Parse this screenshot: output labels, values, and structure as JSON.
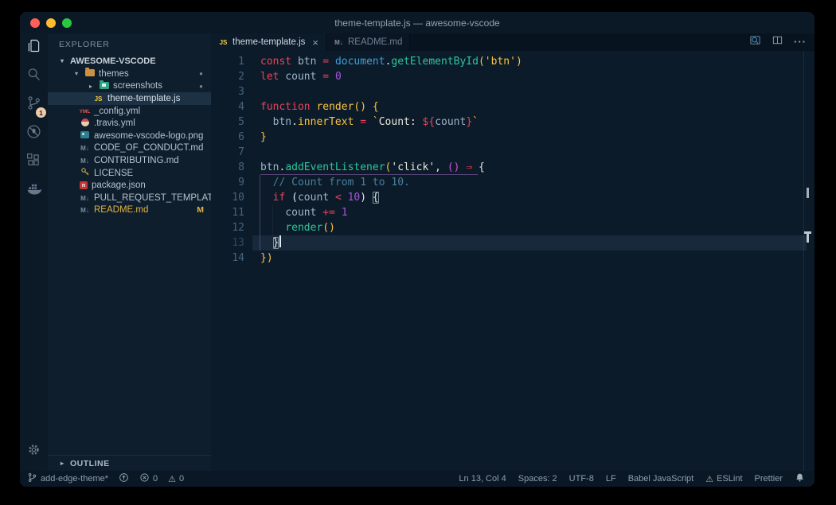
{
  "window": {
    "title": "theme-template.js — awesome-vscode",
    "traffic_lights": {
      "close": "#ff5f57",
      "minimize": "#febc2e",
      "zoom": "#28c840"
    }
  },
  "colors": {
    "keyword_red": "#ee4159",
    "string_yellow": "#fdc33f",
    "method_green": "#2ec59c",
    "object_blue": "#3f9ed8",
    "number_purple": "#a655d8",
    "paren_magenta": "#cf52d8",
    "comment_blue": "#4a7f9d",
    "variable_slate": "#9db4c6",
    "modified_gold": "#e3b341",
    "scm_badge_peach": "#eecaa9",
    "editor_bg": "#0c1b29",
    "sidebar_bg": "#0e1e2d",
    "statusbar_bg": "#0a1724"
  },
  "activity_bar": {
    "items": [
      {
        "icon": "files-icon",
        "active": true
      },
      {
        "icon": "search-icon"
      },
      {
        "icon": "source-control-icon",
        "badge": "1"
      },
      {
        "icon": "debug-icon"
      },
      {
        "icon": "extensions-icon"
      },
      {
        "icon": "docker-icon"
      }
    ],
    "bottom": [
      {
        "icon": "settings-gear-icon"
      }
    ]
  },
  "sidebar": {
    "header": "EXPLORER",
    "root": {
      "label": "AWESOME-VSCODE",
      "arrow": "▾"
    },
    "tree": [
      {
        "label": "themes",
        "icon": "folder-icon",
        "level": 1,
        "arrow": "▾",
        "dot": "●"
      },
      {
        "label": "screenshots",
        "icon": "folder-image-icon",
        "level": 2,
        "arrow": "▸",
        "dot": "●"
      },
      {
        "label": "theme-template.js",
        "icon": "js-icon",
        "level": 2,
        "selected": true
      },
      {
        "label": "_config.yml",
        "icon": "yml-icon",
        "level": 1
      },
      {
        "label": ".travis.yml",
        "icon": "travis-icon",
        "level": 1
      },
      {
        "label": "awesome-vscode-logo.png",
        "icon": "image-icon",
        "level": 1
      },
      {
        "label": "CODE_OF_CONDUCT.md",
        "icon": "md-icon",
        "level": 1
      },
      {
        "label": "CONTRIBUTING.md",
        "icon": "md-icon",
        "level": 1
      },
      {
        "label": "LICENSE",
        "icon": "license-icon",
        "level": 1
      },
      {
        "label": "package.json",
        "icon": "npm-icon",
        "level": 1
      },
      {
        "label": "PULL_REQUEST_TEMPLATE.md",
        "icon": "md-icon",
        "level": 1
      },
      {
        "label": "README.md",
        "icon": "md-icon",
        "level": 1,
        "gold": true,
        "badge": "M"
      }
    ],
    "outline": {
      "label": "OUTLINE",
      "arrow": "▸"
    }
  },
  "icon_glyphs": {
    "js": "JS",
    "yml": "YML",
    "md": "M",
    "npm": "n"
  },
  "tabs": [
    {
      "label": "theme-template.js",
      "icon": "js-icon",
      "active": true,
      "close": "×"
    },
    {
      "label": "README.md",
      "icon": "md-icon",
      "active": false
    }
  ],
  "tab_actions": [
    {
      "icon": "open-preview-icon"
    },
    {
      "icon": "split-editor-icon"
    },
    {
      "icon": "more-actions-icon"
    }
  ],
  "editor": {
    "lines": [
      {
        "n": 1,
        "tokens": [
          [
            "kw",
            "const "
          ],
          [
            "var",
            "btn "
          ],
          [
            "kw",
            "= "
          ],
          [
            "obj",
            "document"
          ],
          [
            "punc",
            "."
          ],
          [
            "green",
            "getElementById"
          ],
          [
            "y",
            "("
          ],
          [
            "y",
            "'btn'"
          ],
          [
            "y",
            ")"
          ]
        ]
      },
      {
        "n": 2,
        "tokens": [
          [
            "kw",
            "let "
          ],
          [
            "var",
            "count "
          ],
          [
            "kw",
            "= "
          ],
          [
            "num",
            "0"
          ]
        ]
      },
      {
        "n": 3,
        "tokens": []
      },
      {
        "n": 4,
        "tokens": [
          [
            "kw",
            "function "
          ],
          [
            "y",
            "render"
          ],
          [
            "y",
            "()"
          ],
          [
            "pl",
            " "
          ],
          [
            "y",
            "{"
          ]
        ]
      },
      {
        "n": 5,
        "tokens": [
          [
            "pl",
            "  "
          ],
          [
            "var",
            "btn"
          ],
          [
            "punc",
            "."
          ],
          [
            "y",
            "innerText "
          ],
          [
            "kw",
            "= "
          ],
          [
            "y",
            "`"
          ],
          [
            "w",
            "Count: "
          ],
          [
            "kw",
            "${"
          ],
          [
            "var",
            "count"
          ],
          [
            "kw",
            "}"
          ],
          [
            "y",
            "`"
          ]
        ]
      },
      {
        "n": 6,
        "tokens": [
          [
            "y",
            "}"
          ]
        ]
      },
      {
        "n": 7,
        "tokens": []
      },
      {
        "n": 8,
        "tokens": [
          [
            "var",
            "btn"
          ],
          [
            "punc",
            "."
          ],
          [
            "green",
            "addEventListener"
          ],
          [
            "y",
            "("
          ],
          [
            "w",
            "'click'"
          ],
          [
            "punc",
            ", "
          ],
          [
            "mag",
            "()"
          ],
          [
            "pl",
            " "
          ],
          [
            "kw",
            "⇒"
          ],
          [
            "pl",
            " "
          ],
          [
            "w",
            "{"
          ]
        ]
      },
      {
        "n": 9,
        "tokens": [
          [
            "pl",
            "  "
          ],
          [
            "com",
            "// Count from 1 to 10."
          ]
        ]
      },
      {
        "n": 10,
        "tokens": [
          [
            "pl",
            "  "
          ],
          [
            "kw",
            "if "
          ],
          [
            "punc",
            "("
          ],
          [
            "var",
            "count "
          ],
          [
            "kw",
            "< "
          ],
          [
            "num",
            "10"
          ],
          [
            "punc",
            ") "
          ],
          [
            "box",
            "{"
          ]
        ]
      },
      {
        "n": 11,
        "tokens": [
          [
            "pl",
            "    "
          ],
          [
            "var",
            "count "
          ],
          [
            "kw",
            "+= "
          ],
          [
            "num",
            "1"
          ]
        ]
      },
      {
        "n": 12,
        "tokens": [
          [
            "pl",
            "    "
          ],
          [
            "green",
            "render"
          ],
          [
            "y",
            "()"
          ]
        ]
      },
      {
        "n": 13,
        "current": true,
        "tokens": [
          [
            "pl",
            "  "
          ],
          [
            "box",
            "}"
          ],
          [
            "cursor",
            ""
          ]
        ]
      },
      {
        "n": 14,
        "tokens": [
          [
            "y",
            "})"
          ]
        ]
      }
    ]
  },
  "status_bar": {
    "left": [
      {
        "icon": "branch-icon",
        "label": "add-edge-theme*"
      },
      {
        "icon": "sync-icon",
        "label": ""
      },
      {
        "icon": "error-icon",
        "label": "0"
      },
      {
        "icon": "warning-icon",
        "label": "0"
      }
    ],
    "right": [
      {
        "label": "Ln 13, Col 4"
      },
      {
        "label": "Spaces: 2"
      },
      {
        "label": "UTF-8"
      },
      {
        "label": "LF"
      },
      {
        "label": "Babel JavaScript"
      },
      {
        "icon": "warning-icon",
        "label": "ESLint"
      },
      {
        "label": "Prettier"
      },
      {
        "icon": "bell-icon",
        "label": ""
      }
    ]
  }
}
